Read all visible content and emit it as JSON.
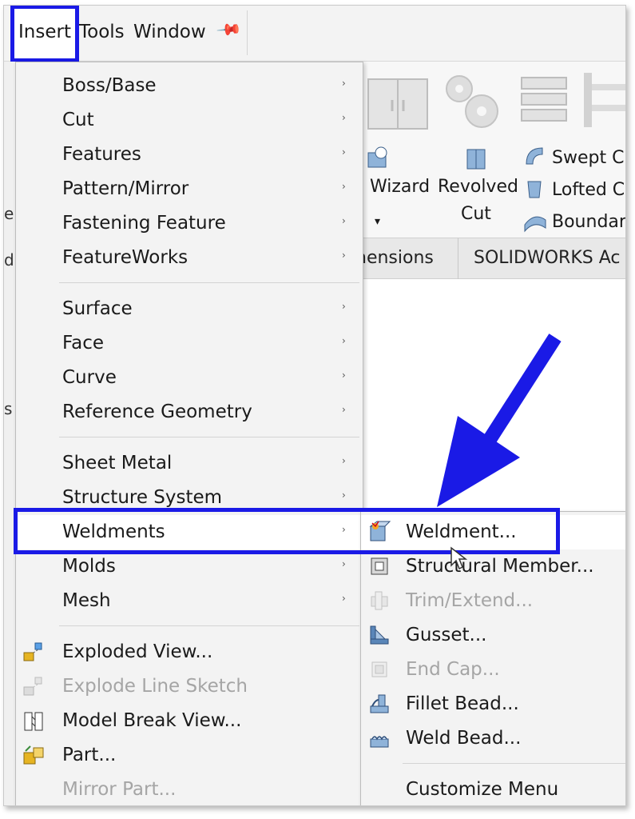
{
  "menubar": {
    "insert": "Insert",
    "tools": "Tools",
    "window": "Window",
    "pin_icon": "pin-icon"
  },
  "ribbon": {
    "wizard": "Wizard",
    "revolved_cut_line1": "Revolved",
    "revolved_cut_line2": "Cut",
    "swept_cut": "Swept Cu",
    "lofted_cut": "Lofted Cu",
    "boundary": "Boundary"
  },
  "tabs": {
    "dimensions": "nensions",
    "solidworks_addins": "SOLIDWORKS Ac"
  },
  "left_fragments": [
    "e",
    "d",
    "s"
  ],
  "insert_menu": {
    "items": [
      {
        "label": "Boss/Base",
        "submenu": true
      },
      {
        "label": "Cut",
        "submenu": true
      },
      {
        "label": "Features",
        "submenu": true
      },
      {
        "label": "Pattern/Mirror",
        "submenu": true
      },
      {
        "label": "Fastening Feature",
        "submenu": true
      },
      {
        "label": "FeatureWorks",
        "submenu": true
      },
      {
        "label": "Surface",
        "submenu": true
      },
      {
        "label": "Face",
        "submenu": true
      },
      {
        "label": "Curve",
        "submenu": true
      },
      {
        "label": "Reference Geometry",
        "submenu": true
      },
      {
        "label": "Sheet Metal",
        "submenu": true
      },
      {
        "label": "Structure System",
        "submenu": true
      },
      {
        "label": "Weldments",
        "submenu": true
      },
      {
        "label": "Molds",
        "submenu": true
      },
      {
        "label": "Mesh",
        "submenu": true
      },
      {
        "label": "Exploded View...",
        "icon": "exploded-view-icon"
      },
      {
        "label": "Explode Line Sketch",
        "icon": "explode-line-sketch-icon",
        "disabled": true
      },
      {
        "label": "Model Break View...",
        "icon": "model-break-view-icon"
      },
      {
        "label": "Part...",
        "icon": "part-icon"
      },
      {
        "label": "Mirror Part...",
        "disabled": true
      }
    ]
  },
  "weldments_submenu": {
    "items": [
      {
        "label": "Weldment...",
        "icon": "weldment-icon"
      },
      {
        "label": "Structural Member...",
        "icon": "structural-member-icon"
      },
      {
        "label": "Trim/Extend...",
        "icon": "trim-extend-icon",
        "disabled": true
      },
      {
        "label": "Gusset...",
        "icon": "gusset-icon"
      },
      {
        "label": "End Cap...",
        "icon": "end-cap-icon",
        "disabled": true
      },
      {
        "label": "Fillet Bead...",
        "icon": "fillet-bead-icon"
      },
      {
        "label": "Weld Bead...",
        "icon": "weld-bead-icon"
      },
      {
        "label": "Customize Menu"
      }
    ]
  },
  "colors": {
    "highlight_border": "#1a1ae6",
    "arrow": "#1a1ae6",
    "disabled_text": "#a5a5a5"
  }
}
